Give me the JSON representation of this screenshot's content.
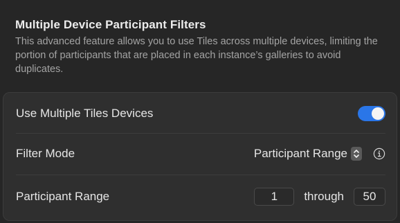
{
  "header": {
    "title": "Multiple Device Participant Filters",
    "description": "This advanced feature allows you to use Tiles across multiple devices, limiting the portion of participants that are placed in each instance’s galleries to avoid duplicates."
  },
  "settings": {
    "multiple_devices": {
      "label": "Use Multiple Tiles Devices",
      "enabled": true
    },
    "filter_mode": {
      "label": "Filter Mode",
      "selected": "Participant Range"
    },
    "participant_range": {
      "label": "Participant Range",
      "start": "1",
      "separator": "through",
      "end": "50"
    }
  },
  "colors": {
    "accent": "#2a76e8",
    "background": "#262626",
    "panel": "#2f2f2f"
  },
  "icons": {
    "stepper": "chevron-up-down-icon",
    "info": "info-circle-icon"
  }
}
